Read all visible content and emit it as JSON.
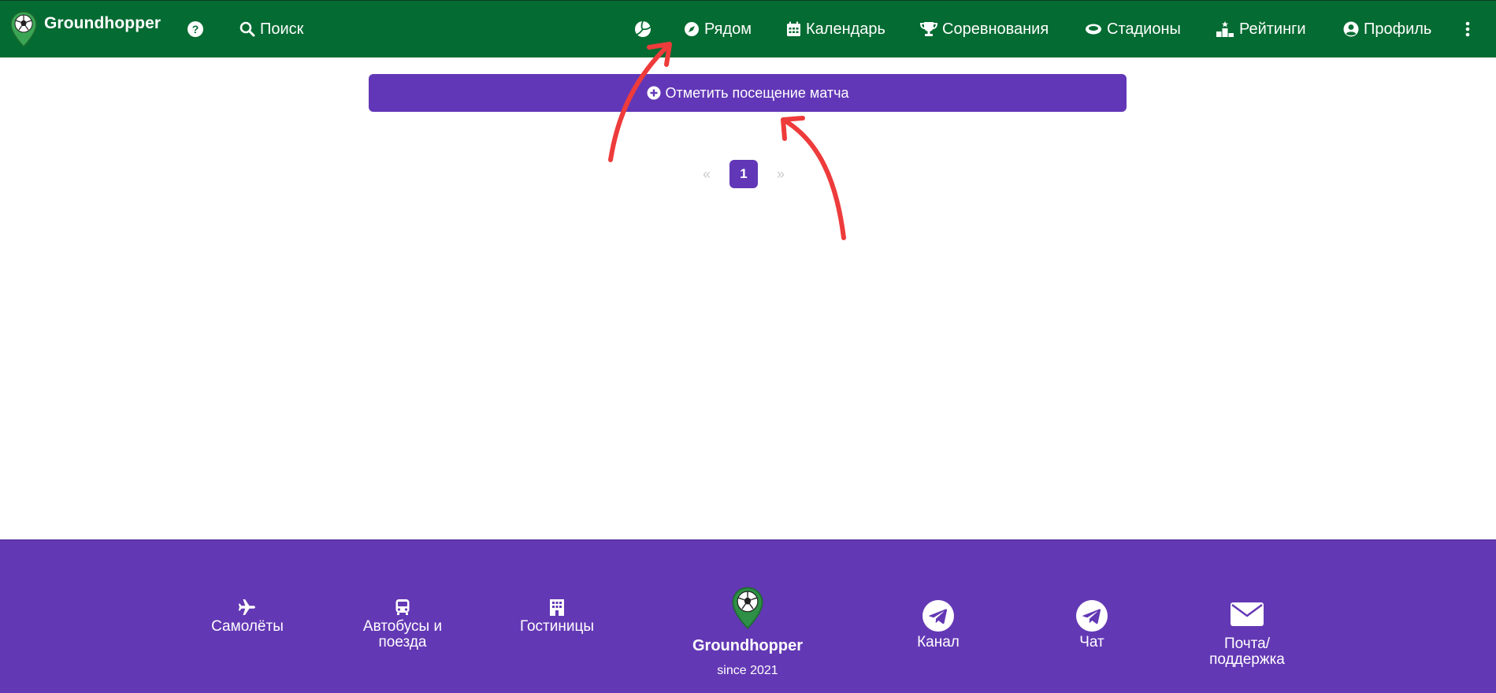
{
  "navbar": {
    "brand": "Groundhopper",
    "search": "Поиск",
    "nearby": "Рядом",
    "calendar": "Календарь",
    "competitions": "Соревнования",
    "stadiums": "Стадионы",
    "ratings": "Рейтинги",
    "profile": "Профиль"
  },
  "main": {
    "mark_visit_label": "Отметить посещение матча",
    "pagination": {
      "prev": "«",
      "current": "1",
      "next": "»"
    }
  },
  "footer": {
    "planes": "Самолёты",
    "buses_line1": "Автобусы и",
    "buses_line2": "поезда",
    "hotels": "Гостиницы",
    "brand": "Groundhopper",
    "since": "since 2021",
    "channel": "Канал",
    "chat": "Чат",
    "mail_line1": "Почта/",
    "mail_line2": "поддержка"
  },
  "colors": {
    "navbar_bg": "#046b32",
    "accent_purple": "#6237b7",
    "annotation_red": "#ee3b3b"
  }
}
